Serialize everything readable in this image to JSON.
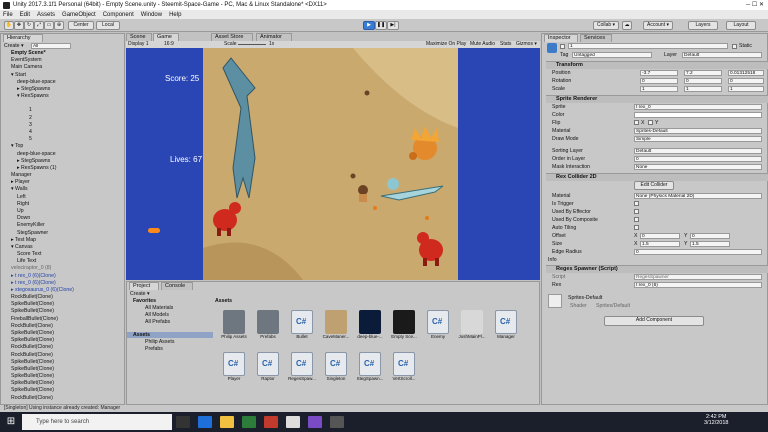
{
  "window": {
    "title": "Unity 2017.3.1f1 Personal (64bit) - Empty Scene.unity - Steemit-Space-Game - PC, Mac & Linux Standalone* <DX11>"
  },
  "menu": [
    "File",
    "Edit",
    "Assets",
    "GameObject",
    "Component",
    "Window",
    "Help"
  ],
  "toolbar": {
    "center": "Center",
    "local": "Local",
    "collab": "Collab ▾",
    "account": "Account ▾",
    "layers": "Layers",
    "layout": "Layout"
  },
  "hierarchy": {
    "tab": "Hierarchy",
    "create": "Create ▾",
    "search_placeholder": "All",
    "items": [
      "Empty Scene*",
      "EventSystem",
      "Main Camera",
      "▾ Start",
      "deep-blue-space",
      "▸ StegSpawns",
      "▾ RexSpawns",
      "",
      "1",
      "2",
      "3",
      "4",
      "5",
      "▾ Top",
      "deep-blue-space",
      "▸ StegSpawns",
      "▸ RexSpawns (1)",
      "Manager",
      "▸ Player",
      "▾ Walls",
      "Left",
      "Right",
      "Up",
      "Down",
      "EnemyKiller",
      "StegSpawner",
      "▸ Test Map",
      "▾ Canvas",
      "Score Text",
      "Life Text",
      "velociraptor_0 (8)",
      "▸ t rex_0 (6)(Clone)",
      "▸ t rex_0 (6)(Clone)",
      "▸ stegosaurus_0 (6)(Clone)",
      "RockBullet(Clone)",
      "SpikeBullet(Clone)",
      "SpikeBullet(Clone)",
      "FireballBullet(Clone)",
      "RockBullet(Clone)",
      "SpikeBullet(Clone)",
      "SpikeBullet(Clone)",
      "RockBullet(Clone)",
      "RockBullet(Clone)",
      "SpikeBullet(Clone)",
      "SpikeBullet(Clone)",
      "SpikeBullet(Clone)",
      "SpikeBullet(Clone)",
      "SpikeBullet(Clone)",
      "RockBullet(Clone)"
    ]
  },
  "scene": {
    "tabs": [
      "Scene",
      "Game",
      "Asset Store",
      "Animator"
    ],
    "display": "Display 1",
    "aspect": "16:9",
    "scale_label": "Scale",
    "scale_value": "1x",
    "options": [
      "Maximize On Play",
      "Mute Audio",
      "Stats",
      "Gizmos ▾"
    ]
  },
  "game": {
    "score": "Score: 25",
    "lives": "Lives: 67"
  },
  "project": {
    "tabs": [
      "Project",
      "Console"
    ],
    "create": "Create ▾",
    "favorites_title": "Favorites",
    "favorites": [
      "All Materials",
      "All Models",
      "All Prefabs"
    ],
    "assets_title": "Assets",
    "assets_tree": [
      "Philip Assets",
      "Prefabs"
    ],
    "breadcrumb": "Assets",
    "items_row1": [
      "Philip Assets",
      "Prefabs",
      "Bullet",
      "CaveManer...",
      "deep-blue-...",
      "Empty Sce...",
      "Enemy",
      "JoshMainPl...",
      "Manager"
    ],
    "items_row2": [
      "Player",
      "Raptor",
      "RegesSpaw...",
      "Singleton",
      "StegSpawn...",
      "VertScroll..."
    ]
  },
  "inspector": {
    "tabs": [
      "Inspector",
      "Services"
    ],
    "object_name": "1",
    "static_label": "Static",
    "tag_label": "Tag",
    "tag_value": "Untagged",
    "layer_label": "Layer",
    "layer_value": "Default",
    "transform": {
      "title": "Transform",
      "rows": [
        {
          "label": "Position",
          "x": "-3.7",
          "y": "7.2",
          "z": "0.01312518"
        },
        {
          "label": "Rotation",
          "x": "0",
          "y": "0",
          "z": "0"
        },
        {
          "label": "Scale",
          "x": "1",
          "y": "1",
          "z": "1"
        }
      ]
    },
    "sprite_renderer": {
      "title": "Sprite Renderer",
      "sprite": "t rex_0",
      "color_label": "Color",
      "flip_label": "Flip",
      "flip_x": "X",
      "flip_y": "Y",
      "material": "Sprites-Default",
      "draw_mode": "Simple",
      "sorting_layer": "Default",
      "order_in_layer": "0",
      "mask_interaction": "None"
    },
    "rex_collider": {
      "title": "Rex Collider 2D",
      "edit_collider": "Edit Collider",
      "material": "None (Physics Material 2D)",
      "is_trigger_label": "Is Trigger",
      "used_by_effector": "Used By Effector",
      "used_by_composite": "Used By Composite",
      "auto_tiling": "Auto Tiling",
      "offset_x": "0",
      "offset_y": "0",
      "size_x": "1.5",
      "size_y": "1.5",
      "edge_radius": "0",
      "info": "Info"
    },
    "spawner": {
      "title": "Reges Spawner (Script)",
      "script_label": "Script",
      "script_value": "RegesSpawner",
      "rex_label": "Rex",
      "rex_value": "t rex_0 (6)"
    },
    "material": {
      "name": "Sprites-Default",
      "shader_label": "Shader",
      "shader_value": "Sprites/Default"
    },
    "add_component": "Add Component",
    "labels": [
      "Sprite",
      "Color",
      "Flip",
      "Material",
      "Draw Mode",
      "Sorting Layer",
      "Order in Layer",
      "Mask Interaction",
      "Material",
      "Is Trigger",
      "Used By Effector",
      "Used By Composite",
      "Auto Tiling",
      "Offset",
      "Size",
      "Edge Radius"
    ]
  },
  "status": "[Singleton] Using instance already created: Manager",
  "taskbar": {
    "search": "Type here to search",
    "time": "2:42 PM",
    "date": "3/12/2018"
  },
  "colors": {
    "game_sand": "#c9a96e",
    "game_bg": "#2a46b4",
    "play_blue": "#3a7bd5"
  }
}
